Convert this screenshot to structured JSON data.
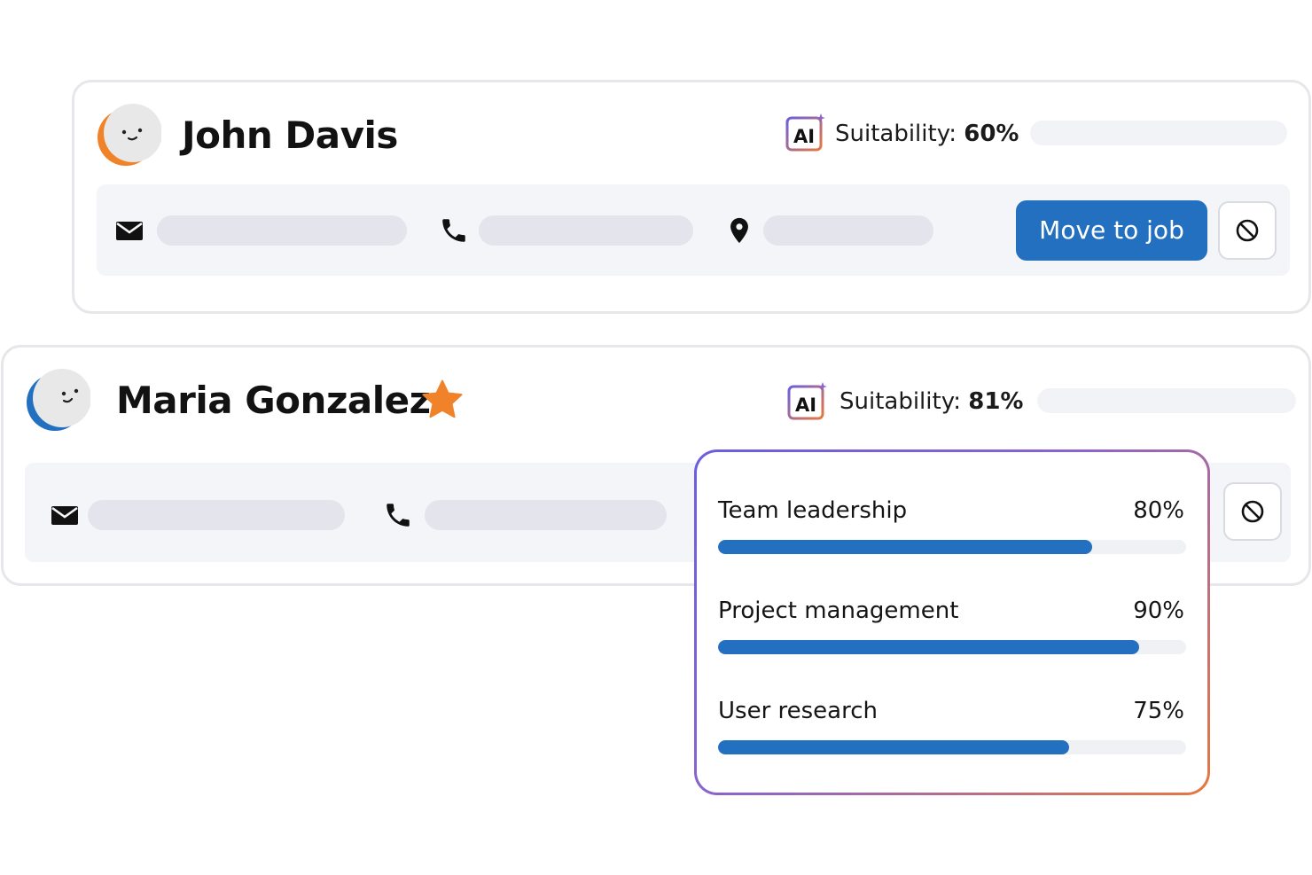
{
  "colors": {
    "primary": "#2370c0",
    "accent_orange": "#f0822a",
    "ai_gradient_start": "#6a5ee0",
    "ai_gradient_end": "#e7783f",
    "placeholder": "#e3e4ec"
  },
  "candidates": [
    {
      "name": "John Davis",
      "avatar_color": "#f0822a",
      "ai_badge": "AI",
      "suitability_label": "Suitability:",
      "suitability_value": "60%",
      "contact_icons": [
        "envelope-icon",
        "phone-icon",
        "location-pin-icon"
      ],
      "move_button_label": "Move to job",
      "block_icon": "block-icon"
    },
    {
      "name": "Maria Gonzalez",
      "avatar_color": "#2370c0",
      "starred": true,
      "ai_badge": "AI",
      "suitability_label": "Suitability:",
      "suitability_value": "81%",
      "contact_icons": [
        "envelope-icon",
        "phone-icon"
      ],
      "block_icon": "block-icon"
    }
  ],
  "skills_popover": {
    "skills": [
      {
        "label": "Team leadership",
        "percent_text": "80%",
        "value": 0.8
      },
      {
        "label": "Project management",
        "percent_text": "90%",
        "value": 0.9
      },
      {
        "label": "User research",
        "percent_text": "75%",
        "value": 0.75
      }
    ]
  }
}
